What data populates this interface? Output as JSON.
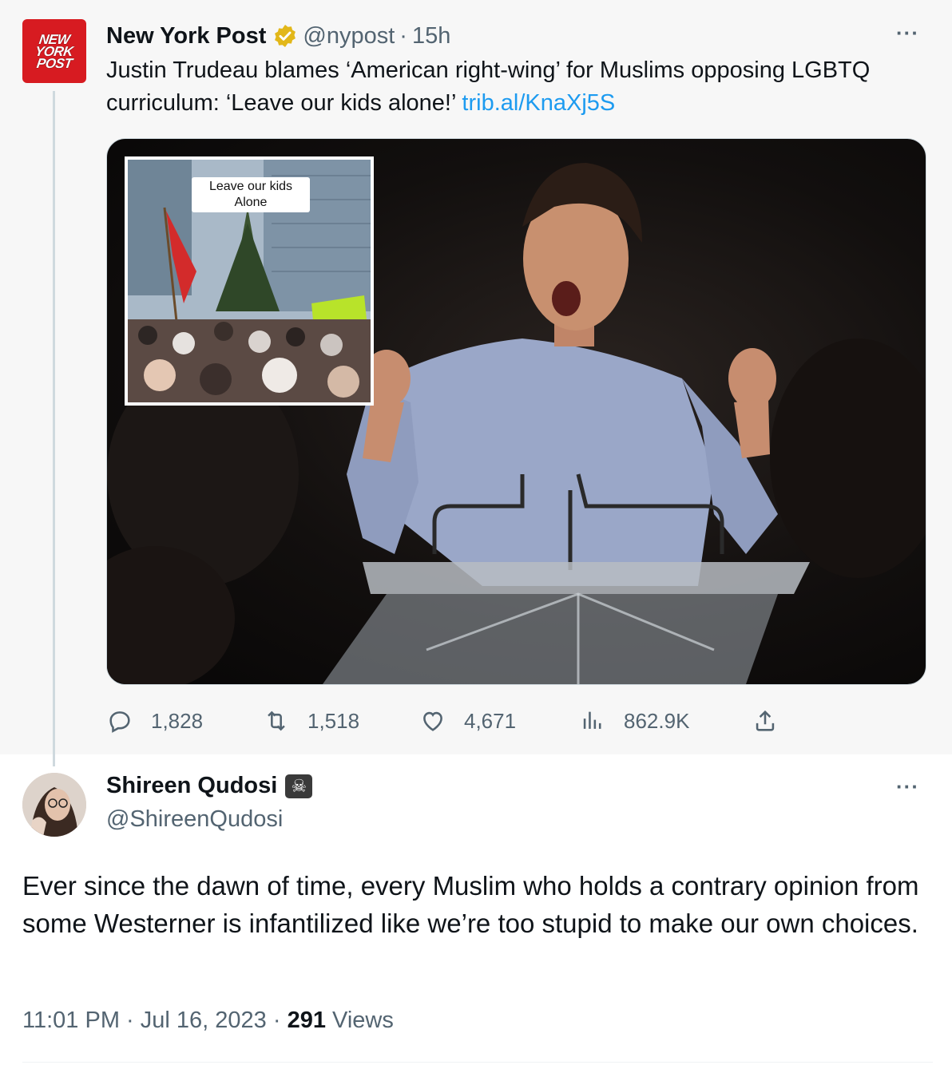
{
  "quoted_tweet": {
    "logo_lines": [
      "NEW",
      "YORK",
      "POST"
    ],
    "name": "New York Post",
    "handle": "@nypost",
    "separator": "·",
    "time": "15h",
    "text": "Justin Trudeau blames ‘American right-wing’ for Muslims opposing LGBTQ curriculum: ‘Leave our kids alone!’",
    "link": "trib.al/KnaXj5S",
    "inset_caption": "Leave our kids Alone",
    "metrics": {
      "replies": "1,828",
      "retweets": "1,518",
      "likes": "4,671",
      "views": "862.9K"
    }
  },
  "tweet": {
    "name": "Shireen Qudosi",
    "name_badge": "☠",
    "handle": "@ShireenQudosi",
    "text": "Ever since the dawn of time, every Muslim who holds a contrary opinion from some Westerner is infantilized like we’re too stupid to make our own choices.",
    "time": "11:01 PM",
    "separator": "·",
    "date": "Jul 16, 2023",
    "views_count": "291",
    "views_label": "Views"
  },
  "more_label": "···",
  "colors": {
    "accent": "#1d9bf0",
    "secondary_text": "#536471",
    "nyp_red": "#d71b21",
    "verified_gold": "#e2b719"
  }
}
